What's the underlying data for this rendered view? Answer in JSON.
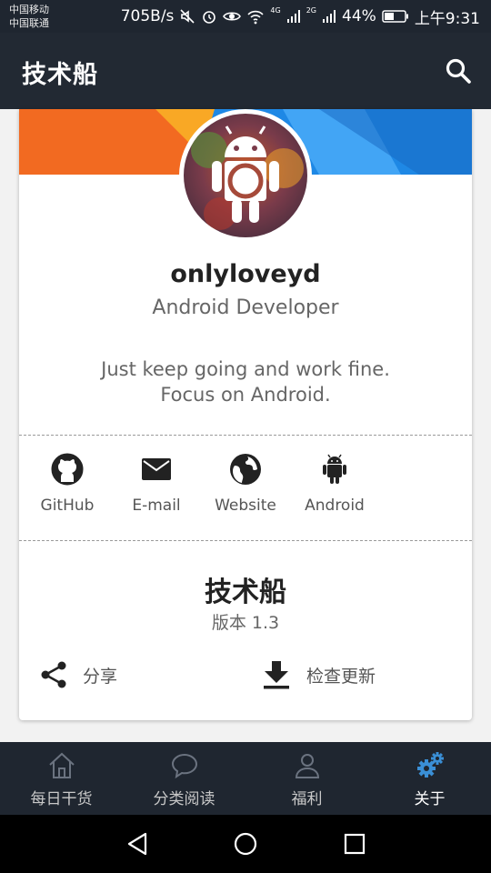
{
  "status_bar": {
    "carrier_1": "中国移动",
    "carrier_2": "中国联通",
    "network_speed": "705B/s",
    "network_tag_1": "4G",
    "network_tag_2": "2G",
    "battery": "44%",
    "time": "上午9:31"
  },
  "app_bar": {
    "title": "技术船",
    "search_icon": "search-icon"
  },
  "profile": {
    "name": "onlyloveyd",
    "role": "Android Developer",
    "motto_line_1": "Just keep going and work fine.",
    "motto_line_2": "Focus on Android."
  },
  "links": [
    {
      "label": "GitHub",
      "icon": "github-icon"
    },
    {
      "label": "E-mail",
      "icon": "email-icon"
    },
    {
      "label": "Website",
      "icon": "globe-icon"
    },
    {
      "label": "Android",
      "icon": "android-icon"
    }
  ],
  "app_info": {
    "name": "技术船",
    "version": "版本 1.3"
  },
  "actions": {
    "share_label": "分享",
    "update_label": "检查更新"
  },
  "bottom_nav": [
    {
      "label": "每日干货",
      "icon": "home-icon",
      "active": false
    },
    {
      "label": "分类阅读",
      "icon": "chat-bubble-icon",
      "active": false
    },
    {
      "label": "福利",
      "icon": "person-icon",
      "active": false
    },
    {
      "label": "关于",
      "icon": "gears-icon",
      "active": true
    }
  ],
  "colors": {
    "app_bar": "#222933",
    "status_bar": "#1f2630",
    "accent_blue": "#3a8fd6",
    "banner_orange": "#f26a21",
    "banner_blue": "#1e88e5"
  }
}
